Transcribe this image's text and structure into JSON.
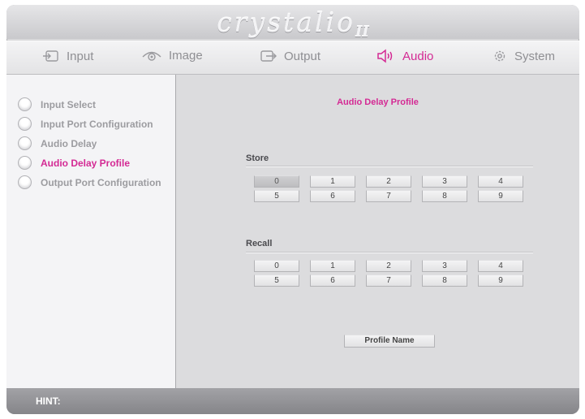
{
  "app": {
    "logo": "crystalio",
    "logo_suffix": "II"
  },
  "nav": {
    "tabs": [
      {
        "label": "Input",
        "icon": "input-icon"
      },
      {
        "label": "Image",
        "icon": "eye-icon"
      },
      {
        "label": "Output",
        "icon": "output-icon"
      },
      {
        "label": "Audio",
        "icon": "speaker-icon"
      },
      {
        "label": "System",
        "icon": "gear-icon"
      }
    ],
    "active": "Audio"
  },
  "sidebar": {
    "items": [
      {
        "label": "Input Select"
      },
      {
        "label": "Input Port Configuration"
      },
      {
        "label": "Audio Delay"
      },
      {
        "label": "Audio Delay Profile"
      },
      {
        "label": "Output Port Configuration"
      }
    ],
    "active": "Audio Delay Profile"
  },
  "main": {
    "title": "Audio Delay Profile",
    "store": {
      "label": "Store",
      "buttons": [
        "0",
        "1",
        "2",
        "3",
        "4",
        "5",
        "6",
        "7",
        "8",
        "9"
      ],
      "selected": "0"
    },
    "recall": {
      "label": "Recall",
      "buttons": [
        "0",
        "1",
        "2",
        "3",
        "4",
        "5",
        "6",
        "7",
        "8",
        "9"
      ]
    },
    "profile_name_label": "Profile Name"
  },
  "hint": {
    "label": "HINT:"
  },
  "colors": {
    "accent": "#d42a94",
    "text": "#9c9ca0",
    "panel": "#dcdcde"
  }
}
